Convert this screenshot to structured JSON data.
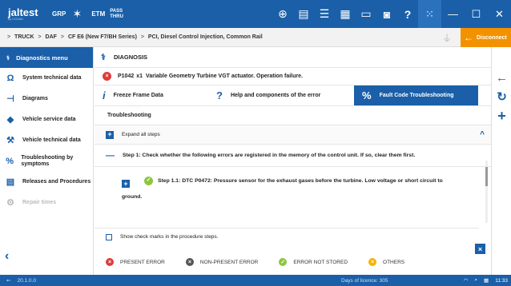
{
  "toolbar": {
    "logo": "jaltest",
    "logo_sub": "by COJALI",
    "grp_label": "GRP",
    "etm_label": "ETM",
    "pass_label_1": "PASS",
    "pass_label_2": "THRU"
  },
  "breadcrumb": {
    "path_bold": "TRUCK",
    "sep": ">",
    "make": "DAF",
    "model": "CF E6 (New F7/BH Series)",
    "system": "PCI, Diesel Control Injection, Common Rail",
    "disconnect_label": "Disconnect"
  },
  "sidebar": {
    "header": "Diagnostics menu",
    "items": [
      {
        "label": "System technical data",
        "icon": "omega-icon"
      },
      {
        "label": "Diagrams",
        "icon": "diagram-icon"
      },
      {
        "label": "Vehicle service data",
        "icon": "oil-can-icon"
      },
      {
        "label": "Vehicle technical data",
        "icon": "wrench-icon"
      },
      {
        "label": "Troubleshooting by symptoms",
        "icon": "troubleshoot-icon"
      },
      {
        "label": "Releases and Procedures",
        "icon": "document-icon"
      },
      {
        "label": "Repair times",
        "icon": "gear-icon"
      }
    ]
  },
  "main": {
    "header": "DIAGNOSIS",
    "error_code": "P1042",
    "error_count": "x1",
    "error_text": "Variable Geometry Turbine VGT actuator. Operation failure.",
    "tabs": [
      {
        "label": "Freeze Frame Data",
        "icon": "i"
      },
      {
        "label": "Help and components of the error",
        "icon": "?"
      },
      {
        "label": "Fault Code Troubleshooting",
        "icon": "%"
      }
    ],
    "section_title": "Troubleshooting",
    "expand_label": "Expand all steps",
    "step1": "Step 1: Check whether the following errors are registered in the memory of the control unit. If so, clear them first.",
    "step11_a": "Step 1.1:  DTC P0472: Pressure sensor for the exhaust gases before the turbine. Low voltage or short circuit to",
    "step11_b": "ground.",
    "show_marks": "Show check marks in the procedure steps."
  },
  "legend": [
    {
      "label": "PRESENT ERROR",
      "color": "#e03a3a",
      "glyph": "×"
    },
    {
      "label": "NON-PRESENT ERROR",
      "color": "#555555",
      "glyph": "×"
    },
    {
      "label": "ERROR NOT STORED",
      "color": "#8dc63f",
      "glyph": "✓"
    },
    {
      "label": "OTHERS",
      "color": "#f5b400",
      "glyph": "×"
    }
  ],
  "status": {
    "version": "20.1.0.0",
    "licence": "Days of licence: 305",
    "time": "11:33"
  },
  "colors": {
    "primary": "#1a5fa8",
    "accent": "#f39200"
  }
}
